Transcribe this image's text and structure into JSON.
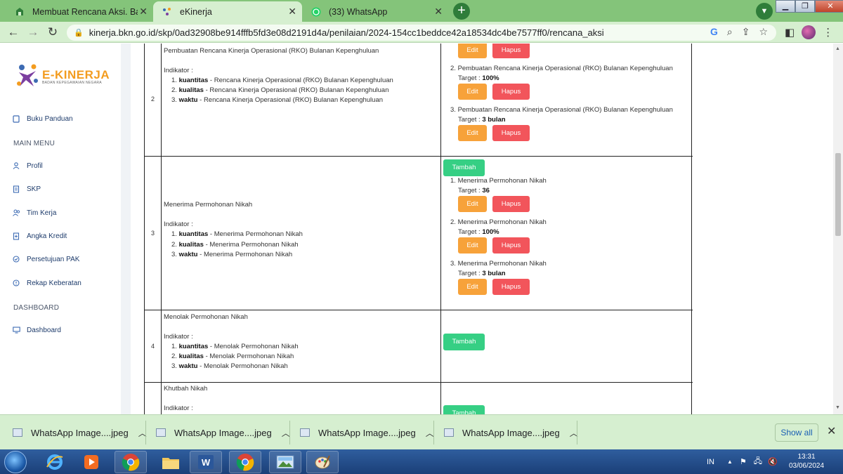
{
  "browser": {
    "tabs": [
      {
        "title": "Membuat Rencana Aksi. Bagian I",
        "active": false
      },
      {
        "title": "eKinerja",
        "active": true
      },
      {
        "title": "(33) WhatsApp",
        "active": false
      }
    ],
    "url": "kinerja.bkn.go.id/skp/0ad32908be914fffb5fd3e08d2191d4a/penilaian/2024-154cc1beddce42a18534dc4be7577ff0/rencana_aksi"
  },
  "sidebar": {
    "logo_name": "E-KINERJA",
    "logo_sub": "BADAN KEPEGAWAIAN NEGARA",
    "guide": "Buku Panduan",
    "main_menu_heading": "MAIN MENU",
    "main_menu": [
      "Profil",
      "SKP",
      "Tim Kerja",
      "Angka Kredit",
      "Persetujuan PAK",
      "Rekap Keberatan"
    ],
    "dashboard_heading": "DASHBOARD",
    "dashboard_item": "Dashboard"
  },
  "table": {
    "indicator_label": "Indikator :",
    "edit_label": "Edit",
    "hapus_label": "Hapus",
    "tambah_label": "Tambah",
    "target_label": "Target :",
    "rows": [
      {
        "no": "2",
        "title": "Pembuatan Rencana Kinerja Operasional (RKO) Bulanan Kepenghuluan",
        "indicators": [
          {
            "kind": "kuantitas",
            "text": " - Rencana Kinerja Operasional (RKO) Bulanan Kepenghuluan"
          },
          {
            "kind": "kualitas",
            "text": " - Rencana Kinerja Operasional (RKO) Bulanan Kepenghuluan"
          },
          {
            "kind": "waktu",
            "text": " - Rencana Kinerja Operasional (RKO) Bulanan Kepenghuluan"
          }
        ],
        "actions": [
          {
            "text": "Pembuatan Rencana Kinerja Operasional (RKO) Bulanan Kepenghuluan",
            "target": "100%"
          },
          {
            "text": "Pembuatan Rencana Kinerja Operasional (RKO) Bulanan Kepenghuluan",
            "target": "3 bulan"
          }
        ]
      },
      {
        "no": "3",
        "title": "Menerima Permohonan Nikah",
        "indicators": [
          {
            "kind": "kuantitas",
            "text": " - Menerima Permohonan Nikah"
          },
          {
            "kind": "kualitas",
            "text": " - Menerima Permohonan Nikah"
          },
          {
            "kind": "waktu",
            "text": " - Menerima Permohonan Nikah"
          }
        ],
        "actions": [
          {
            "text": "Menerima Permohonan Nikah",
            "target": "36"
          },
          {
            "text": "Menerima Permohonan Nikah",
            "target": "100%"
          },
          {
            "text": "Menerima Permohonan Nikah",
            "target": "3 bulan"
          }
        ]
      },
      {
        "no": "4",
        "title": "Menolak Permohonan Nikah",
        "indicators": [
          {
            "kind": "kuantitas",
            "text": " - Menolak Permohonan Nikah"
          },
          {
            "kind": "kualitas",
            "text": " - Menolak Permohonan Nikah"
          },
          {
            "kind": "waktu",
            "text": " - Menolak Permohonan Nikah"
          }
        ],
        "actions": []
      },
      {
        "no": "",
        "title": "Khutbah Nikah",
        "indicators": [],
        "actions": []
      }
    ]
  },
  "downloads": {
    "items": [
      "WhatsApp Image....jpeg",
      "WhatsApp Image....jpeg",
      "WhatsApp Image....jpeg",
      "WhatsApp Image....jpeg"
    ],
    "show_all": "Show all"
  },
  "taskbar": {
    "lang": "IN",
    "time": "13:31",
    "date": "03/06/2024"
  },
  "colors": {
    "edit": "#f7a23a",
    "hapus": "#f2555b",
    "tambah": "#36cf84",
    "chrome_frame": "#84c47a",
    "chrome_toolbar": "#d6efd0",
    "brand": "#f39c1f"
  }
}
